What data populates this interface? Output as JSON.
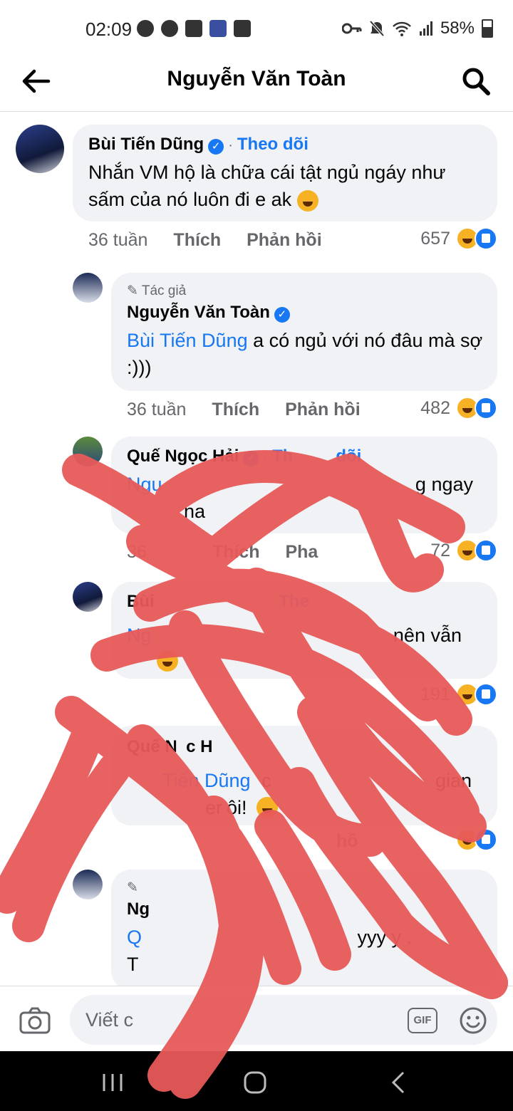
{
  "status_bar": {
    "time": "02:09",
    "battery": "58%"
  },
  "header": {
    "title": "Nguyễn Văn Toàn"
  },
  "comments": [
    {
      "name": "Bùi Tiến Dũng",
      "follow": "Theo dõi",
      "text": "Nhắn VM hộ là chữa cái tật ngủ ngáy như sấm của nó luôn đi e ak",
      "time": "36 tuần",
      "like": "Thích",
      "reply": "Phản hồi",
      "reactions": "657"
    },
    {
      "author_tag": "Tác giả",
      "name": "Nguyễn Văn Toàn",
      "mention": "Bùi Tiến Dũng",
      "text": " a có ngủ với nó đâu mà sợ :)))",
      "time": "36 tuần",
      "like": "Thích",
      "reply": "Phản hồi",
      "reactions": "482"
    },
    {
      "name": "Quế Ngọc Hải",
      "follow": "Th",
      "follow_tail": "dõi",
      "text_start": "Ngu",
      "text_end": "g ngay",
      "line2": "na",
      "time": "36",
      "like": "Thích",
      "reply": "Pha",
      "reactions": "72"
    },
    {
      "name": "Bùi",
      "follow": "The",
      "text_start": "Ng",
      "text_end": "nên vẫn",
      "reactions": "191"
    },
    {
      "name": "Quế N",
      "name_tail": "c H",
      "mention": "Tiến Dũng",
      "text_mid": "c",
      "text_end": "gian",
      "line2": "er",
      "line2_b": "ôi!",
      "reply": "hồ"
    },
    {
      "name": "Ng",
      "mention": "Q",
      "text_end": "yyy y .",
      "line2": "T"
    }
  ],
  "composer": {
    "placeholder": "Viết c",
    "gif_label": "GIF"
  }
}
